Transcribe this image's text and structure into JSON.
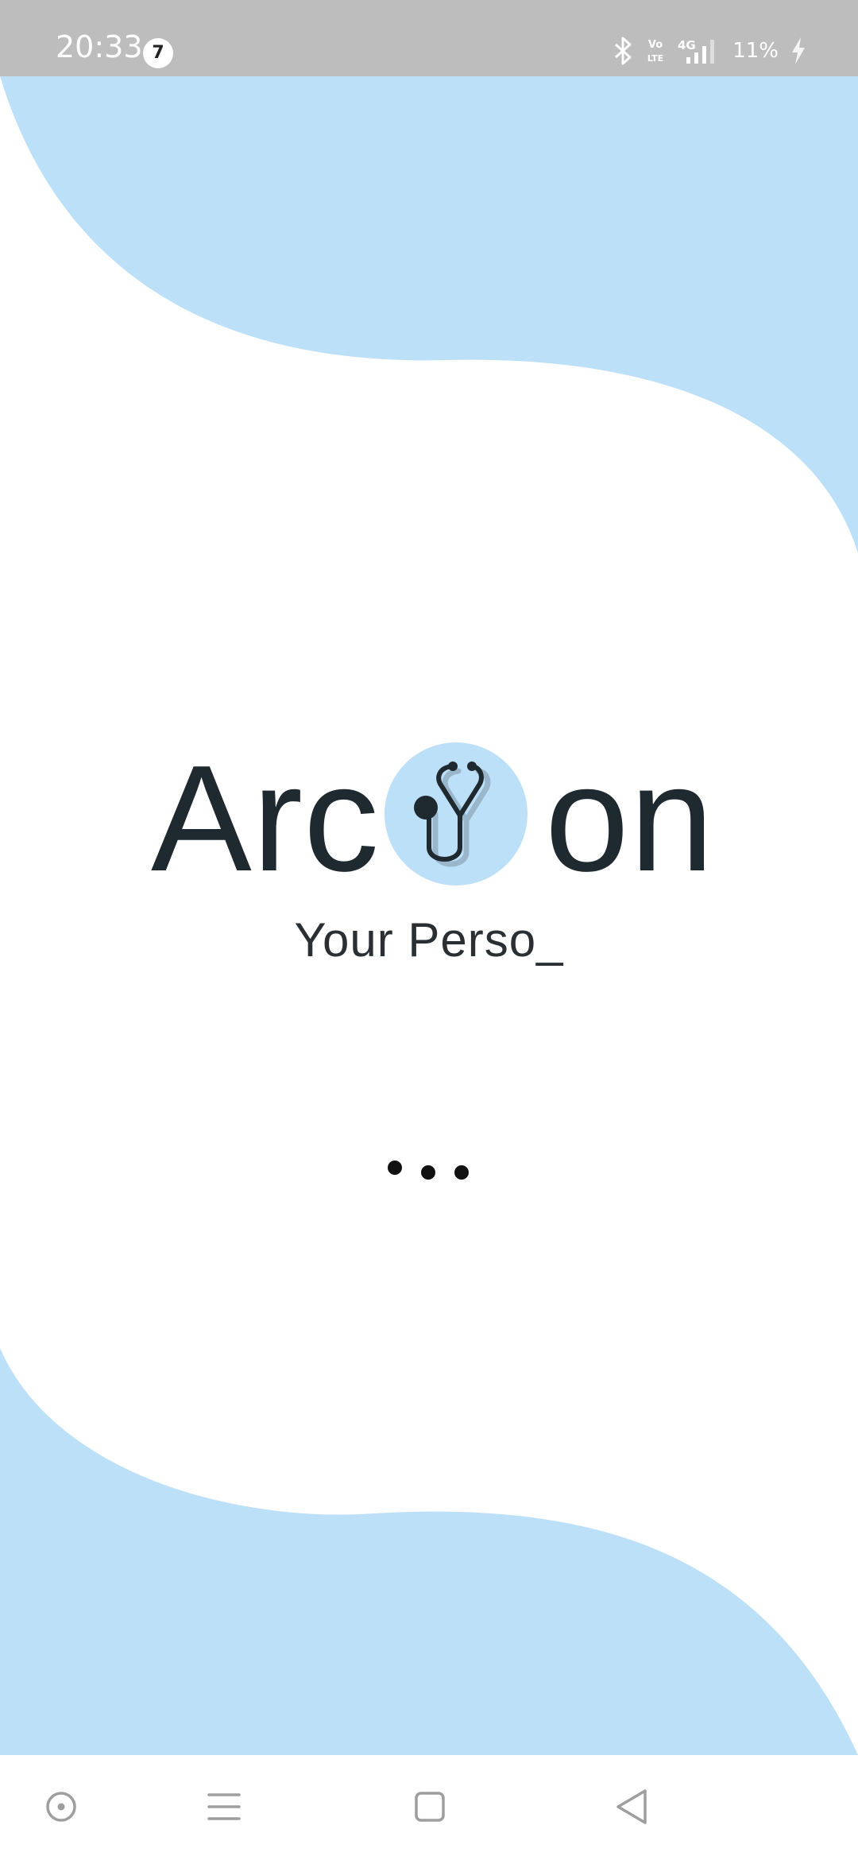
{
  "status_bar": {
    "time": "20:33",
    "notification_count": "7",
    "battery_percent": "11%",
    "icons": [
      "bluetooth-icon",
      "volte-icon",
      "signal-4g-icon",
      "battery-charging-icon"
    ],
    "volte_top": "Vo",
    "volte_bottom": "LTE",
    "network_type": "4G"
  },
  "app": {
    "name_part_1": "Arc",
    "name_part_2": "on",
    "logo_icon": "stethoscope-icon",
    "tagline": "Your Perso_"
  },
  "loading": {
    "dot_count": 3
  },
  "nav_bar": {
    "buttons": [
      "assistant-button",
      "menu-button",
      "home-button",
      "back-button"
    ]
  },
  "colors": {
    "accent_light_blue": "#bde0f9",
    "text_dark": "#1f2930",
    "status_bar_bg": "#bdbdbd"
  }
}
